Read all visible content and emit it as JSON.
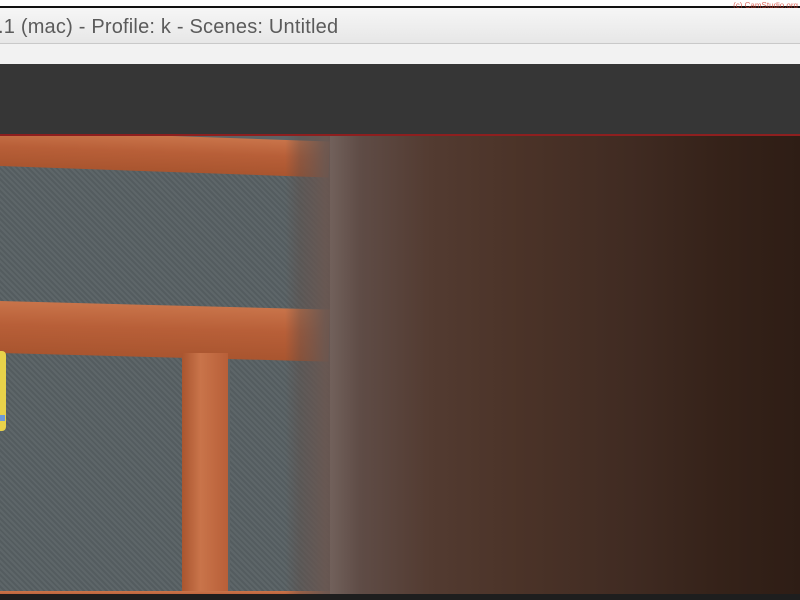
{
  "window": {
    "title": ".1 (mac) - Profile: k - Scenes: Untitled"
  },
  "watermark": {
    "text": "(c) CamStudio.org"
  },
  "colors": {
    "title_bar": "#eeeeee",
    "toolbar": "#363636",
    "preview_border": "#8e1f1f",
    "title_text": "#5b5b5b"
  },
  "preview": {
    "description": "camera preview"
  }
}
